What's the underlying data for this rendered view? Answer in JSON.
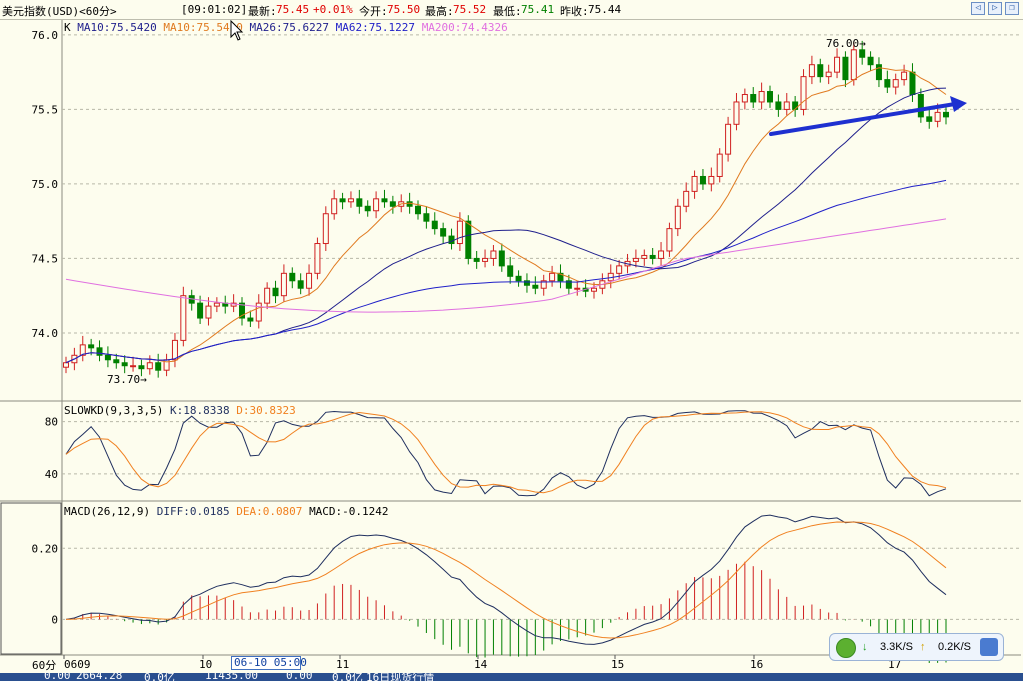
{
  "header": {
    "instrument": "美元指数(USD)<60分>",
    "time": "[09:01:02]",
    "latest_label": "最新:",
    "latest_value": "75.45",
    "change": "+0.01%",
    "open_label": "今开:",
    "open_value": "75.50",
    "high_label": "最高:",
    "high_value": "75.52",
    "low_label": "最低:",
    "low_value": "75.41",
    "prev_label": "昨收:",
    "prev_value": "75.44"
  },
  "legend_main": {
    "k": "K",
    "ma10a": "MA10:75.5420",
    "ma10b": "MA10:75.5420",
    "ma26": "MA26:75.6227",
    "ma62": "MA62:75.1227",
    "ma200": "MA200:74.4326"
  },
  "legend_kd": {
    "name": "SLOWKD(9,3,3,5)",
    "k": "K:18.8338",
    "d": "D:30.8323"
  },
  "legend_macd": {
    "name": "MACD(26,12,9)",
    "diff": "DIFF:0.0185",
    "dea": "DEA:0.0807",
    "macd": "MACD:-0.1242"
  },
  "annotations": {
    "high": "76.00",
    "low": "73.70"
  },
  "axis": {
    "period": "60分",
    "selected_date": "06-10 05:00"
  },
  "statusbar": {
    "items": [
      "0.00",
      "2664.28",
      "0.0亿",
      "11435.00",
      "0.00",
      "0.0亿",
      "16日现货行情"
    ]
  },
  "net_panel": {
    "down": "3.3K/S",
    "up": "0.2K/S"
  },
  "colors": {
    "background": "#FDFDEE",
    "up": "#D02020",
    "down": "#008000",
    "ma10": "#E07A20",
    "ma26": "#1F1F8C",
    "ma62": "#2020C8",
    "ma200": "#E070E0",
    "trendline": "#1E30D0",
    "kd_k": "#1F2F5F",
    "kd_d": "#F08020"
  },
  "chart_data": [
    {
      "type": "candlestick",
      "title": "美元指数(USD)<60分>",
      "x_tick_labels": [
        "0609",
        "10",
        "11",
        "14",
        "15",
        "16",
        "17"
      ],
      "ylim": [
        73.55,
        76.1
      ],
      "yticks": [
        74.0,
        74.5,
        75.0,
        75.5,
        76.0
      ],
      "grid": true,
      "series": [
        {
          "name": "K",
          "close": [
            73.8,
            73.85,
            73.92,
            73.9,
            73.85,
            73.82,
            73.8,
            73.78,
            73.78,
            73.76,
            73.8,
            73.75,
            73.82,
            73.95,
            74.25,
            74.2,
            74.1,
            74.18,
            74.2,
            74.18,
            74.2,
            74.1,
            74.08,
            74.2,
            74.3,
            74.25,
            74.4,
            74.35,
            74.3,
            74.4,
            74.6,
            74.8,
            74.9,
            74.88,
            74.9,
            74.85,
            74.82,
            74.9,
            74.88,
            74.85,
            74.88,
            74.85,
            74.8,
            74.75,
            74.7,
            74.65,
            74.6,
            74.75,
            74.5,
            74.48,
            74.5,
            74.55,
            74.45,
            74.38,
            74.35,
            74.32,
            74.3,
            74.35,
            74.4,
            74.35,
            74.3,
            74.3,
            74.28,
            74.3,
            74.35,
            74.4,
            74.45,
            74.48,
            74.5,
            74.52,
            74.5,
            74.55,
            74.7,
            74.85,
            74.95,
            75.05,
            75.0,
            75.05,
            75.2,
            75.4,
            75.55,
            75.6,
            75.55,
            75.62,
            75.55,
            75.5,
            75.55,
            75.5,
            75.72,
            75.8,
            75.72,
            75.75,
            75.85,
            75.7,
            75.9,
            75.85,
            75.8,
            75.7,
            75.65,
            75.7,
            75.75,
            75.6,
            75.45,
            75.42,
            75.48,
            75.45
          ]
        },
        {
          "name": "MA10",
          "values": "MA10:75.5420"
        },
        {
          "name": "MA26",
          "values": "MA26:75.6227"
        },
        {
          "name": "MA62",
          "values": "MA62:75.1227"
        },
        {
          "name": "MA200",
          "values": "MA200:74.4326"
        }
      ],
      "annotations": [
        {
          "text": "76.00"
        },
        {
          "text": "73.70"
        }
      ]
    },
    {
      "type": "line",
      "title": "SLOWKD(9,3,3,5)",
      "yticks": [
        40,
        80
      ],
      "ylim": [
        20,
        95
      ],
      "series": [
        {
          "name": "K",
          "last": 18.8338
        },
        {
          "name": "D",
          "last": 30.8323
        }
      ]
    },
    {
      "type": "bar",
      "title": "MACD(26,12,9)",
      "yticks": [
        0,
        0.2
      ],
      "ylim": [
        -0.1,
        0.33
      ],
      "series": [
        {
          "name": "DIFF",
          "last": 0.0185
        },
        {
          "name": "DEA",
          "last": 0.0807
        },
        {
          "name": "MACD",
          "last": -0.1242
        }
      ]
    }
  ]
}
